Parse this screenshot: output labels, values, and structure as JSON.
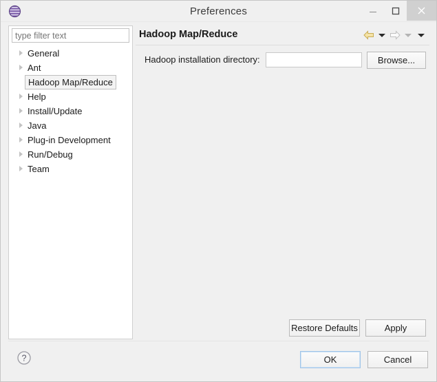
{
  "window": {
    "title": "Preferences",
    "app_icon": "eclipse-sphere-icon",
    "controls": {
      "minimize": "minimize-icon",
      "maximize": "maximize-icon",
      "close": "close-icon"
    }
  },
  "filter": {
    "placeholder": "type filter text",
    "value": ""
  },
  "tree": {
    "items": [
      {
        "label": "General",
        "expandable": true,
        "selected": false
      },
      {
        "label": "Ant",
        "expandable": true,
        "selected": false
      },
      {
        "label": "Hadoop Map/Reduce",
        "expandable": false,
        "selected": true
      },
      {
        "label": "Help",
        "expandable": true,
        "selected": false
      },
      {
        "label": "Install/Update",
        "expandable": true,
        "selected": false
      },
      {
        "label": "Java",
        "expandable": true,
        "selected": false
      },
      {
        "label": "Plug-in Development",
        "expandable": true,
        "selected": false
      },
      {
        "label": "Run/Debug",
        "expandable": true,
        "selected": false
      },
      {
        "label": "Team",
        "expandable": true,
        "selected": false
      }
    ]
  },
  "page": {
    "title": "Hadoop Map/Reduce",
    "nav": {
      "back_icon": "back-arrow-icon",
      "back_enabled": true,
      "back_menu_icon": "chevron-down-icon",
      "forward_icon": "forward-arrow-icon",
      "forward_enabled": false,
      "forward_menu_icon": "chevron-down-icon",
      "view_menu_icon": "chevron-down-icon"
    },
    "form": {
      "directory_label": "Hadoop installation directory:",
      "directory_value": "",
      "directory_placeholder": "",
      "browse_label": "Browse..."
    },
    "restore_defaults_label": "Restore Defaults",
    "apply_label": "Apply"
  },
  "footer": {
    "help_icon": "help-question-icon",
    "ok_label": "OK",
    "cancel_label": "Cancel"
  },
  "colors": {
    "window_background": "#f0f0f0",
    "panel_white": "#ffffff",
    "border": "#cfcfcf",
    "accent_arrow": "#e8d08a",
    "default_button_focus": "#9fc4e8",
    "close_hover": "#d0d0d0",
    "text": "#1a1a1a"
  }
}
